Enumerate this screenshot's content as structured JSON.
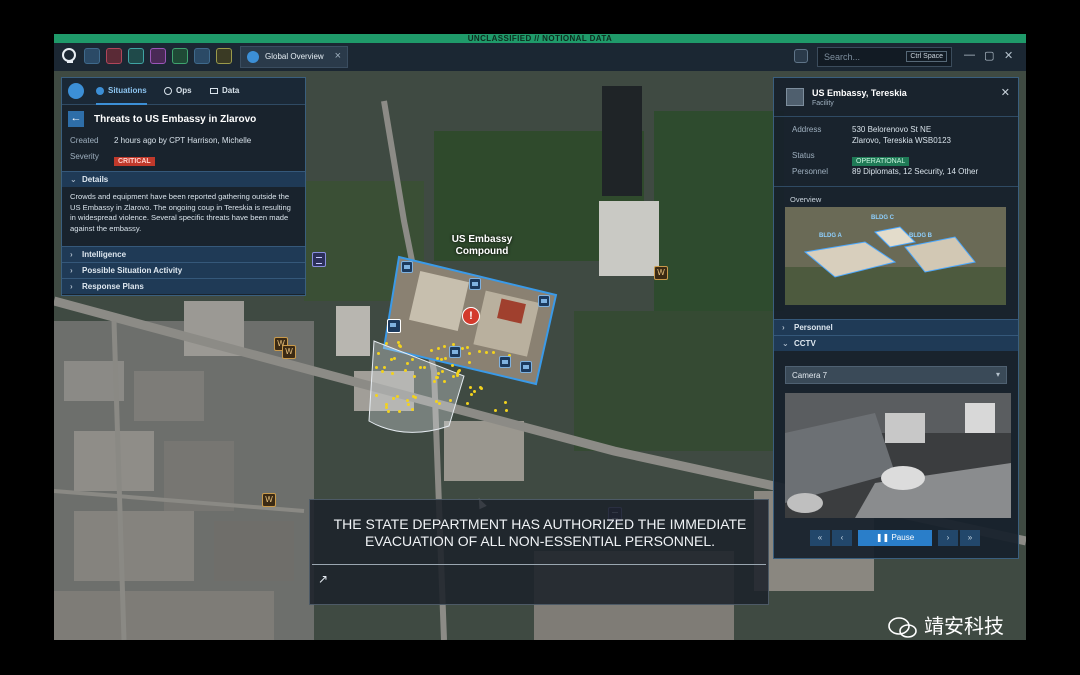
{
  "classification": "UNCLASSIFIED // NOTIONAL DATA",
  "tab": {
    "label": "Global Overview"
  },
  "search": {
    "placeholder": "Search...",
    "shortcut": "Ctrl Space"
  },
  "map": {
    "compound_label_1": "US Embassy",
    "compound_label_2": "Compound"
  },
  "situation_panel": {
    "tabs": [
      "Situations",
      "Ops",
      "Data"
    ],
    "title": "Threats to US Embassy in Zlarovo",
    "created_label": "Created",
    "created_value": "2 hours ago by CPT Harrison, Michelle",
    "severity_label": "Severity",
    "severity_value": "CRITICAL",
    "details_label": "Details",
    "details_text": "Crowds and equipment have been reported gathering outside the US Embassy in Zlarovo. The ongoing coup in Tereskia is resulting in widespread violence. Several specific threats have been made against the embassy.",
    "sections": [
      "Intelligence",
      "Possible Situation Activity",
      "Response Plans"
    ]
  },
  "facility_panel": {
    "title": "US Embassy, Tereskia",
    "subtitle": "Facility",
    "address_label": "Address",
    "address_line1": "530 Belorenovo St NE",
    "address_line2": "Zlarovo, Tereskia   WSB0123",
    "status_label": "Status",
    "status_value": "OPERATIONAL",
    "personnel_label": "Personnel",
    "personnel_value": "89 Diplomats, 12 Security, 14 Other",
    "overview_label": "Overview",
    "bldg_a": "BLDG A",
    "bldg_b": "BLDG B",
    "bldg_c": "BLDG C",
    "section_personnel": "Personnel",
    "section_cctv": "CCTV",
    "camera_select": "Camera 7",
    "pause_label": "Pause"
  },
  "caption": {
    "line1": "THE STATE DEPARTMENT HAS AUTHORIZED THE IMMEDIATE",
    "line2": "EVACUATION OF ALL NON-ESSENTIAL PERSONNEL."
  },
  "watermark": "靖安科技",
  "colors": {
    "accent": "#3c8fd6",
    "critical": "#c0392b",
    "operational": "#1f7a56",
    "classbar": "#1f9a6a"
  }
}
